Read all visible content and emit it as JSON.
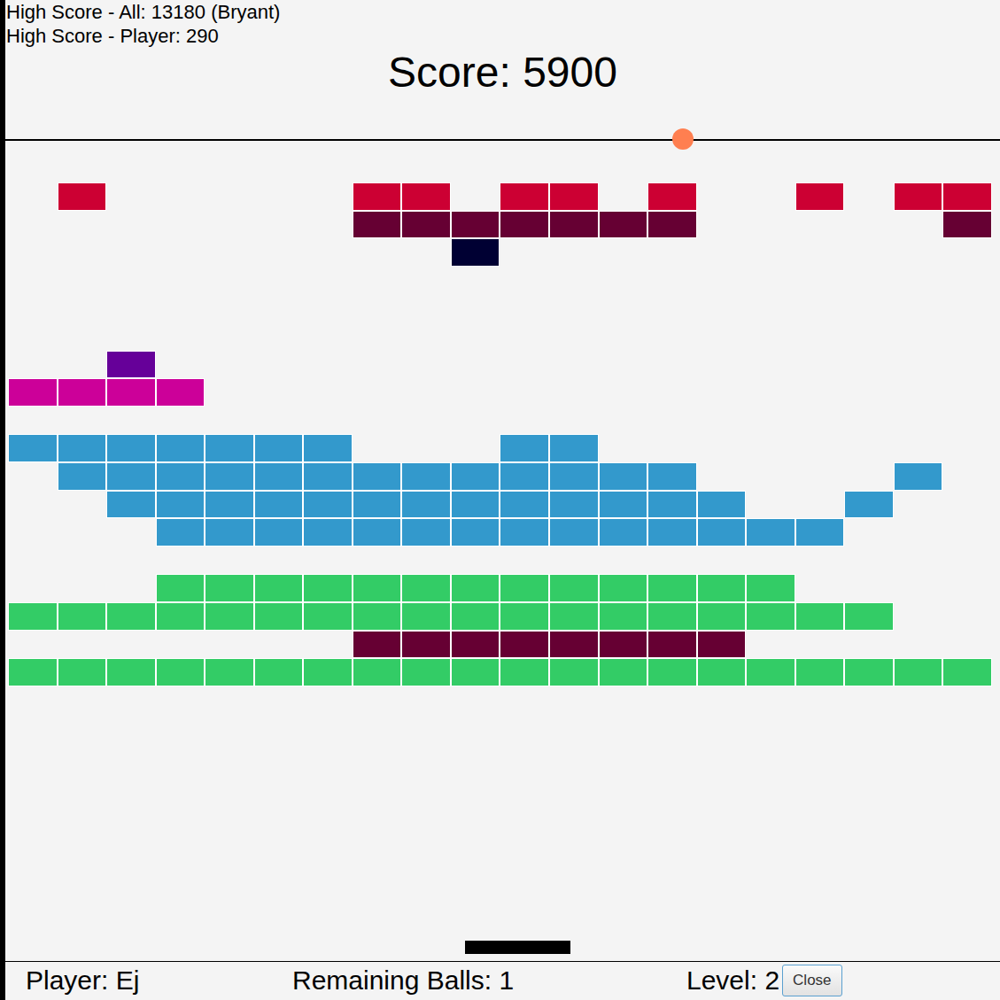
{
  "header": {
    "high_score_all": "High Score - All: 13180 (Bryant)",
    "high_score_player": "High Score - Player: 290",
    "score": "Score: 5900"
  },
  "board": {
    "rows": [
      {
        "color": "#cc0033",
        "cells": [
          false,
          true,
          false,
          false,
          false,
          false,
          false,
          true,
          true,
          false,
          true,
          true,
          false,
          true,
          false,
          false,
          true,
          false,
          true,
          true
        ]
      },
      {
        "color": "#660033",
        "cells": [
          false,
          false,
          false,
          false,
          false,
          false,
          false,
          true,
          true,
          true,
          true,
          true,
          true,
          true,
          false,
          false,
          false,
          false,
          false,
          true
        ]
      },
      {
        "color": "#000033",
        "cells": [
          false,
          false,
          false,
          false,
          false,
          false,
          false,
          false,
          false,
          true,
          false,
          false,
          false,
          false,
          false,
          false,
          false,
          false,
          false,
          false
        ]
      },
      {
        "color": "#f4f4f4",
        "cells": [
          false,
          false,
          false,
          false,
          false,
          false,
          false,
          false,
          false,
          false,
          false,
          false,
          false,
          false,
          false,
          false,
          false,
          false,
          false,
          false
        ]
      },
      {
        "color": "#f4f4f4",
        "cells": [
          false,
          false,
          false,
          false,
          false,
          false,
          false,
          false,
          false,
          false,
          false,
          false,
          false,
          false,
          false,
          false,
          false,
          false,
          false,
          false
        ]
      },
      {
        "color": "#f4f4f4",
        "cells": [
          false,
          false,
          false,
          false,
          false,
          false,
          false,
          false,
          false,
          false,
          false,
          false,
          false,
          false,
          false,
          false,
          false,
          false,
          false,
          false
        ]
      },
      {
        "color": "#660099",
        "cells": [
          false,
          false,
          true,
          false,
          false,
          false,
          false,
          false,
          false,
          false,
          false,
          false,
          false,
          false,
          false,
          false,
          false,
          false,
          false,
          false
        ]
      },
      {
        "color": "#cc0099",
        "cells": [
          true,
          true,
          true,
          true,
          false,
          false,
          false,
          false,
          false,
          false,
          false,
          false,
          false,
          false,
          false,
          false,
          false,
          false,
          false,
          false
        ]
      },
      {
        "color": "#f4f4f4",
        "cells": [
          false,
          false,
          false,
          false,
          false,
          false,
          false,
          false,
          false,
          false,
          false,
          false,
          false,
          false,
          false,
          false,
          false,
          false,
          false,
          false
        ]
      },
      {
        "color": "#3399cc",
        "cells": [
          true,
          true,
          true,
          true,
          true,
          true,
          true,
          false,
          false,
          false,
          true,
          true,
          false,
          false,
          false,
          false,
          false,
          false,
          false,
          false
        ]
      },
      {
        "color": "#3399cc",
        "cells": [
          false,
          true,
          true,
          true,
          true,
          true,
          true,
          true,
          true,
          true,
          true,
          true,
          true,
          true,
          false,
          false,
          false,
          false,
          true,
          false
        ]
      },
      {
        "color": "#3399cc",
        "cells": [
          false,
          false,
          true,
          true,
          true,
          true,
          true,
          true,
          true,
          true,
          true,
          true,
          true,
          true,
          true,
          false,
          false,
          true,
          false,
          false
        ]
      },
      {
        "color": "#3399cc",
        "cells": [
          false,
          false,
          false,
          true,
          true,
          true,
          true,
          true,
          true,
          true,
          true,
          true,
          true,
          true,
          true,
          true,
          true,
          false,
          false,
          false
        ]
      },
      {
        "color": "#f4f4f4",
        "cells": [
          false,
          false,
          false,
          false,
          false,
          false,
          false,
          false,
          false,
          false,
          false,
          false,
          false,
          false,
          false,
          false,
          false,
          false,
          false,
          false
        ]
      },
      {
        "color": "#33cc66",
        "cells": [
          false,
          false,
          false,
          true,
          true,
          true,
          true,
          true,
          true,
          true,
          true,
          true,
          true,
          true,
          true,
          true,
          false,
          false,
          false,
          false
        ]
      },
      {
        "color": "#33cc66",
        "cells": [
          true,
          true,
          true,
          true,
          true,
          true,
          true,
          true,
          true,
          true,
          true,
          true,
          true,
          true,
          true,
          true,
          true,
          true,
          false,
          false
        ]
      },
      {
        "color": "#660033",
        "cells": [
          false,
          false,
          false,
          false,
          false,
          false,
          false,
          true,
          true,
          true,
          true,
          true,
          true,
          true,
          true,
          false,
          false,
          false,
          false,
          false
        ]
      },
      {
        "color": "#33cc66",
        "cells": [
          true,
          true,
          true,
          true,
          true,
          true,
          true,
          true,
          true,
          true,
          true,
          true,
          true,
          true,
          true,
          true,
          true,
          true,
          true,
          true
        ]
      }
    ],
    "ball": {
      "color": "#ff7f50"
    },
    "paddle": {
      "color": "#000000"
    }
  },
  "status_bar": {
    "player": "Player: Ej",
    "remaining_balls": "Remaining Balls: 1",
    "level": "Level: 2",
    "close_button": "Close"
  }
}
